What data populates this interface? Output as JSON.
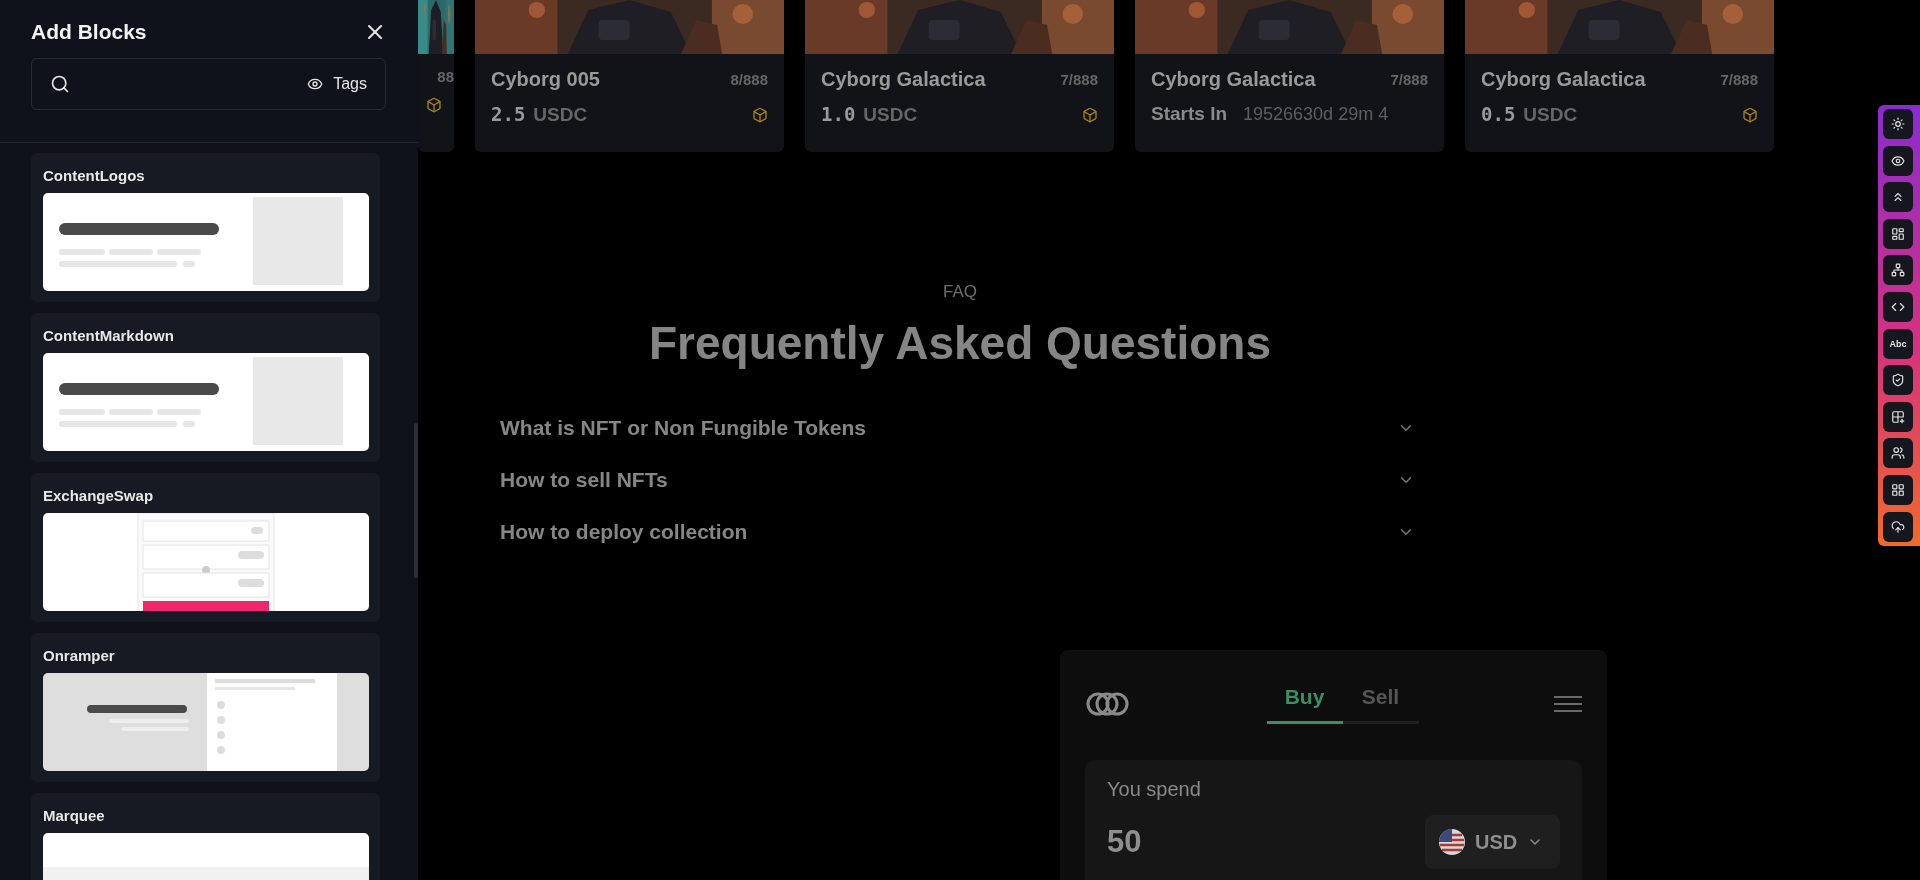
{
  "sidebar": {
    "title": "Add Blocks",
    "search": {
      "tags_label": "Tags"
    },
    "blocks": [
      {
        "name": "ContentLogos",
        "kind": "logos"
      },
      {
        "name": "ContentMarkdown",
        "kind": "markdown"
      },
      {
        "name": "ExchangeSwap",
        "kind": "swap"
      },
      {
        "name": "Onramper",
        "kind": "onramper"
      },
      {
        "name": "Marquee",
        "kind": "marquee"
      }
    ]
  },
  "partial_card": {
    "count": "88"
  },
  "cards": [
    {
      "kind": "price",
      "name": "Cyborg 005",
      "count": "8/888",
      "value": "2.5",
      "unit": "USDC"
    },
    {
      "kind": "price",
      "name": "Cyborg Galactica",
      "count": "7/888",
      "value": "1.0",
      "unit": "USDC"
    },
    {
      "kind": "countdown",
      "name": "Cyborg Galactica",
      "count": "7/888",
      "label": "Starts In",
      "value": "19526630d 29m 4"
    },
    {
      "kind": "price",
      "name": "Cyborg Galactica",
      "count": "7/888",
      "value": "0.5",
      "unit": "USDC"
    }
  ],
  "faq": {
    "eyebrow": "FAQ",
    "title": "Frequently Asked Questions",
    "questions": [
      "What is NFT or Non Fungible Tokens",
      "How to sell NFTs",
      "How to deploy collection"
    ]
  },
  "widget": {
    "tabs": [
      {
        "label": "Buy",
        "selected": true
      },
      {
        "label": "Sell",
        "selected": false
      }
    ],
    "spend_label": "You spend",
    "amount": "50",
    "currency": "USD"
  },
  "toolbar": {
    "text_button": "Abc"
  }
}
